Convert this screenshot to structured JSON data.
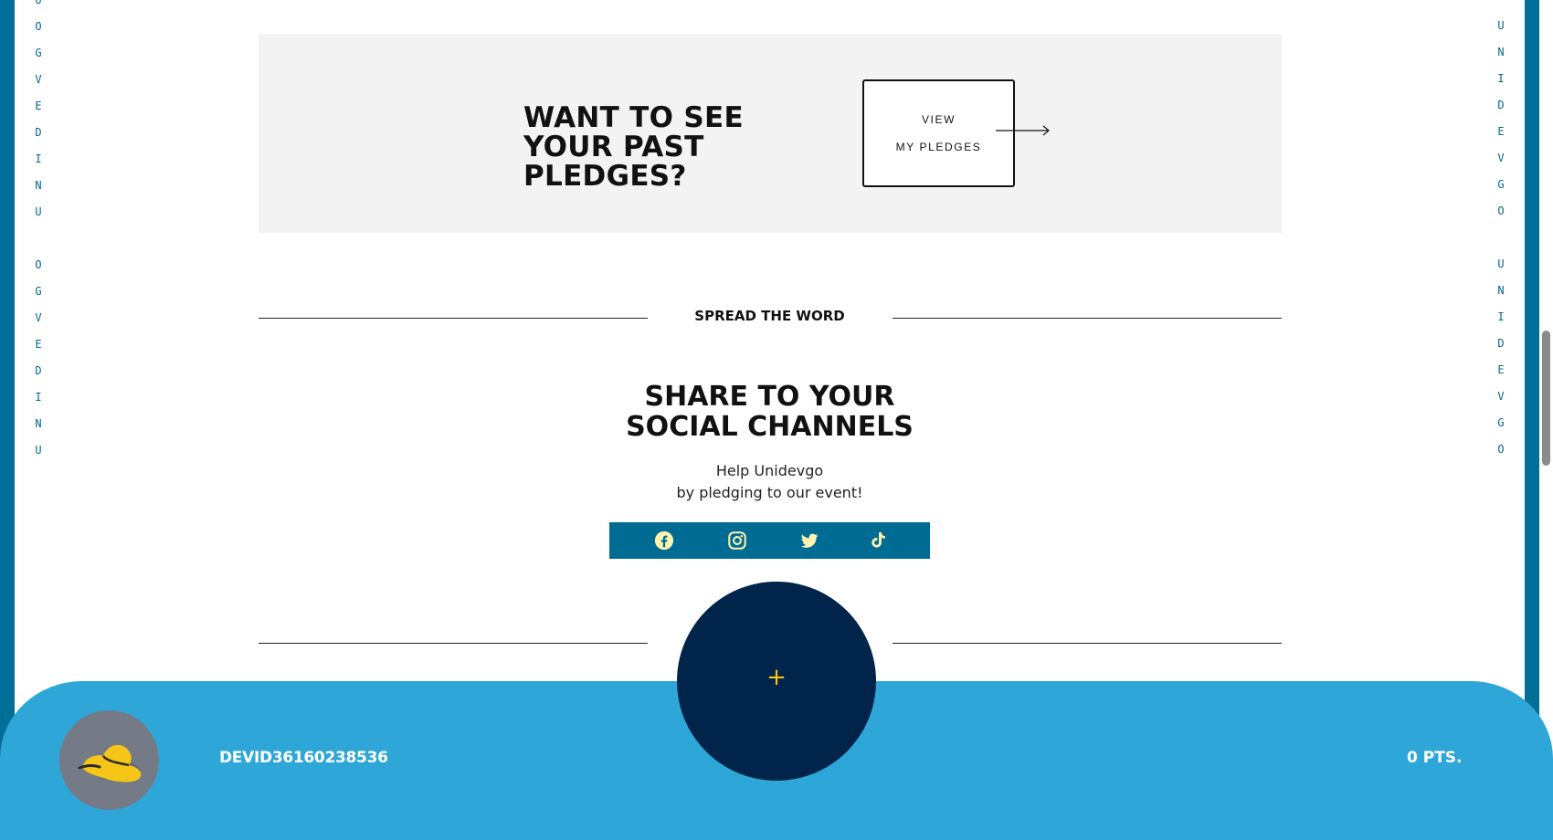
{
  "brand_vertical_left": [
    "U",
    "O",
    "G",
    "V",
    "E",
    "D",
    "I",
    "N",
    "U",
    "",
    "O",
    "G",
    "V",
    "E",
    "D",
    "I",
    "N",
    "U"
  ],
  "brand_vertical_right": [
    "U",
    "N",
    "I",
    "D",
    "E",
    "V",
    "G",
    "O",
    "",
    "U",
    "N",
    "I",
    "D",
    "E",
    "V",
    "G",
    "O"
  ],
  "pledges_banner": {
    "title": "WANT TO SEE YOUR PAST PLEDGES?",
    "button_line1": "VIEW",
    "button_line2": "MY PLEDGES"
  },
  "spread": {
    "label": "SPREAD THE WORD"
  },
  "share": {
    "title": "SHARE TO YOUR SOCIAL CHANNELS",
    "help_line1": "Help Unidevgo",
    "help_line2": "by pledging to our event!"
  },
  "social": {
    "icons": [
      "facebook-icon",
      "instagram-icon",
      "twitter-icon",
      "tiktok-icon"
    ],
    "bar_color": "#006b93",
    "icon_color": "#fff3b0"
  },
  "bottom_bar": {
    "username": "DEVID36160238536",
    "points": "0 PTS.",
    "fab_symbol": "+",
    "bar_color": "#2ea6d8",
    "fab_color": "#00244a"
  },
  "colors": {
    "side_border": "#006e96",
    "banner_bg": "#f3f3f3",
    "accent_yellow": "#f5c518"
  }
}
